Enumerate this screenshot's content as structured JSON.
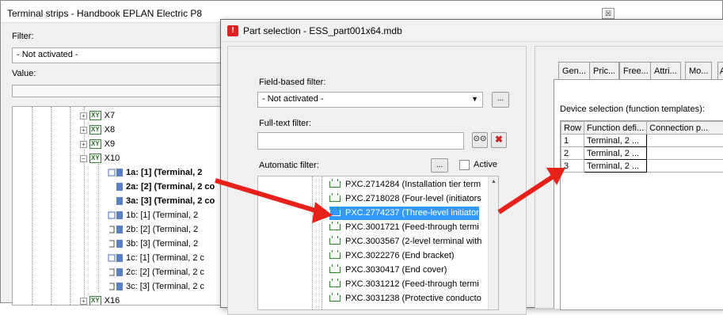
{
  "back_window": {
    "title": "Terminal strips - Handbook EPLAN Electric P8",
    "close_symbol": "☒",
    "filter_label": "Filter:",
    "filter_value": "- Not activated -",
    "value_label": "Value:",
    "tree": {
      "nodes": [
        {
          "label": "X7",
          "expander": "+",
          "tag": "XY"
        },
        {
          "label": "X8",
          "expander": "+",
          "tag": "XY"
        },
        {
          "label": "X9",
          "expander": "+",
          "tag": "XY"
        },
        {
          "label": "X10",
          "expander": "−",
          "tag": "XY"
        },
        {
          "label": "X16",
          "expander": "+",
          "tag": "XY"
        }
      ],
      "terminals": [
        {
          "label": "1a: [1] (Terminal, 2",
          "bold": true
        },
        {
          "label": "2a: [2] (Terminal, 2 co",
          "bold": true
        },
        {
          "label": "3a: [3] (Terminal, 2 co",
          "bold": true
        },
        {
          "label": "1b: [1] (Terminal, 2",
          "bold": false
        },
        {
          "label": "2b: [2] (Terminal, 2",
          "bold": false
        },
        {
          "label": "3b: [3] (Terminal, 2",
          "bold": false
        },
        {
          "label": "1c: [1] (Terminal, 2 c",
          "bold": false
        },
        {
          "label": "2c: [2] (Terminal, 2 c",
          "bold": false
        },
        {
          "label": "3c: [3] (Terminal, 2 c",
          "bold": false
        }
      ]
    }
  },
  "dialog": {
    "title": "Part selection - ESS_part001x64.mdb",
    "title_icon": "warning-icon",
    "field_filter_label": "Field-based filter:",
    "field_filter_value": "- Not activated -",
    "more_button": "...",
    "fulltext_label": "Full-text filter:",
    "auto_filter_label": "Automatic filter:",
    "auto_more_button": "...",
    "active_label": "Active",
    "parts": [
      {
        "label": "PXC.2714284 (Installation tier term",
        "selected": false
      },
      {
        "label": "PXC.2718028 (Four-level (initiators",
        "selected": false
      },
      {
        "label": "PXC.2774237 (Three-level initiator",
        "selected": true
      },
      {
        "label": "PXC.3001721 (Feed-through termi",
        "selected": false
      },
      {
        "label": "PXC.3003567 (2-level terminal with",
        "selected": false
      },
      {
        "label": "PXC.3022276 (End bracket)",
        "selected": false
      },
      {
        "label": "PXC.3030417 (End cover)",
        "selected": false
      },
      {
        "label": "PXC.3031212 (Feed-through termi",
        "selected": false
      },
      {
        "label": "PXC.3031238 (Protective conducto",
        "selected": false
      }
    ],
    "tabs": [
      "Gen...",
      "Pric...",
      "Free...",
      "Attri...",
      "Mo...",
      "A"
    ],
    "device_selection_label": "Device selection (function templates):",
    "grid": {
      "headers": [
        "Row",
        "Function defi...",
        "Connection p..."
      ],
      "rows": [
        [
          "1",
          "Terminal, 2 ...",
          ""
        ],
        [
          "2",
          "Terminal, 2 ...",
          ""
        ],
        [
          "3",
          "Terminal, 2 ...",
          ""
        ]
      ]
    }
  },
  "colors": {
    "selection": "#3399ff",
    "arrow": "#e8201a"
  }
}
